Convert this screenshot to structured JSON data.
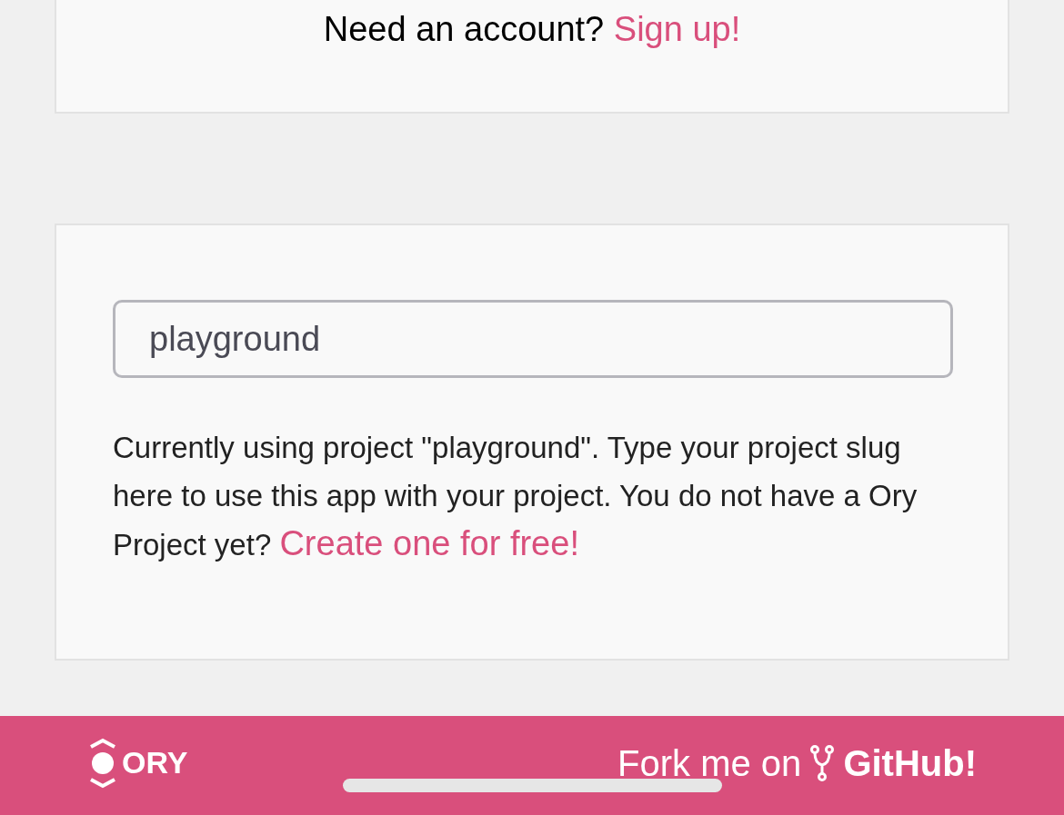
{
  "signup_card": {
    "prompt": "Need an account?",
    "link": "Sign up!"
  },
  "project_card": {
    "field": {
      "value": "playground"
    },
    "help_text": "Currently using project \"playground\". Type your project slug here to use this app with your project. You do not have a Ory Project yet?",
    "link": "Create one for free!"
  },
  "footer": {
    "logo_text": "ORY",
    "fork_text": "Fork me on",
    "github_text": "GitHub!"
  }
}
